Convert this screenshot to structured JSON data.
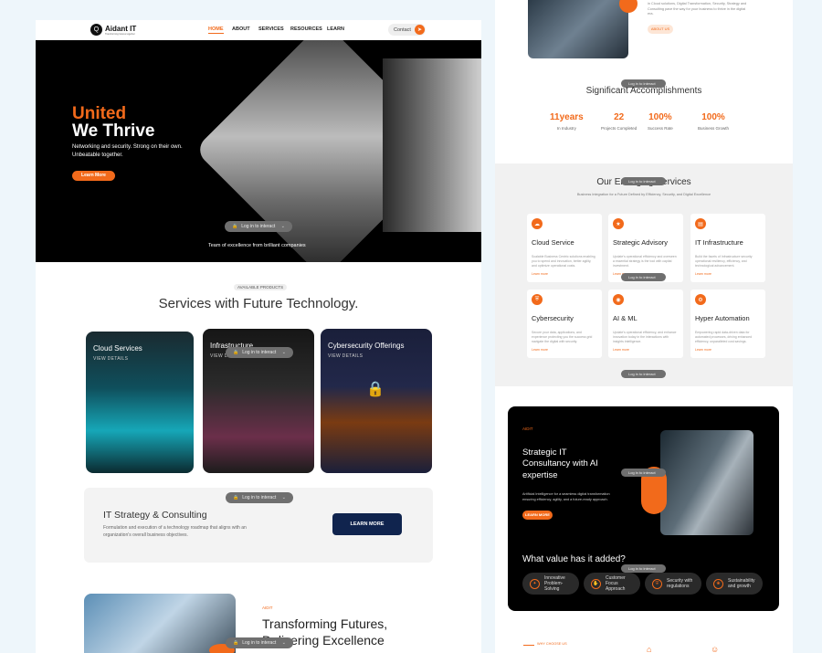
{
  "nav": {
    "logo": "Aidant IT",
    "logo_tagline": "Transforming futures together",
    "links": [
      "HOME",
      "ABOUT",
      "SERVICES",
      "RESOURCES",
      "LEARN"
    ],
    "contact": "Contact"
  },
  "hero": {
    "title_orange": "United",
    "title_white": "We Thrive",
    "subtitle": "Networking and security. Strong on their own. Unbeatable together.",
    "cta": "Learn More",
    "login_pill": "Log in to interact",
    "team_text": "Team of excellence from brilliant companies"
  },
  "products": {
    "badge": "AVAILABLE PRODUCTS",
    "heading": "Services with Future Technology.",
    "cards": [
      {
        "title": "Cloud Services",
        "view": "VIEW DETAILS"
      },
      {
        "title": "Infrastructure",
        "view": "VIEW DETAILS"
      },
      {
        "title": "Cybersecurity Offerings",
        "view": "VIEW DETAILS"
      }
    ],
    "strategy_title": "IT Strategy & Consulting",
    "strategy_desc": "Formulation and execution of a technology roadmap that aligns with an organization's overall business objectives.",
    "strategy_btn": "LEARN MORE"
  },
  "transform": {
    "tag": "AIDIT",
    "heading_line1": "Transforming Futures,",
    "heading_line2": "Delivering Excellence"
  },
  "about": {
    "text": "in Cloud solutions, Digital Transformation, Security, Strategy and Consulting pave the way for your business to thrive in the digital era.",
    "btn": "ABOUT US"
  },
  "accomplishments": {
    "heading": "Significant Accomplishments",
    "stats": [
      {
        "value": "11years",
        "label": "In Industry"
      },
      {
        "value": "22",
        "label": "Projects Completed"
      },
      {
        "value": "100%",
        "label": "Success Rate"
      },
      {
        "value": "100%",
        "label": "Business Growth"
      }
    ]
  },
  "emerging": {
    "heading": "Our Emerging Services",
    "subheading": "Business Integration for a Future Defined by Efficiency, Security, and Digital Excellence",
    "cards": [
      {
        "title": "Cloud Service",
        "desc": "Scalable Business Centric solutions enabling you to spend and innovation, better agility, and optimize operational costs.",
        "link": "Learn more"
      },
      {
        "title": "Strategic Advisory",
        "desc": "Update's operational efficiency and overseen a essential strategy is the tool with capital investment.",
        "link": "Learn more"
      },
      {
        "title": "IT Infrastructure",
        "desc": "Build the facets of Infrastructure security operational resiliency, efficiency, and technological advancement.",
        "link": "Learn more"
      },
      {
        "title": "Cybersecurity",
        "desc": "Secure your data, applications, and experience protecting you the success grid navigate the digital with security.",
        "link": "Learn more"
      },
      {
        "title": "AI & ML",
        "desc": "Update's operational efficiency, and enhance innovation today in the interactions with insights intelligence.",
        "link": "Learn more"
      },
      {
        "title": "Hyper Automation",
        "desc": "Empowering rapid data-driven data for automated processes, driving enhanced efficiency, unparalleled cost savings.",
        "link": "Learn more"
      }
    ]
  },
  "ai": {
    "tag": "AIDIT",
    "heading": "Strategic IT Consultancy with AI expertise",
    "desc": "Artificial Intelligence for a seamless digital transformation ensuring efficiency, agility, and a future-ready approach.",
    "btn": "LEARN MORE",
    "value_heading": "What value has it added?",
    "chips": [
      "Innovative Problem-Solving",
      "Customer Focus Approach",
      "Security with regulations",
      "Sustainability and growth"
    ]
  },
  "why": {
    "tag": "WHY CHOOSE US"
  },
  "colors": {
    "accent": "#f26a1b",
    "dark": "#000000",
    "page_bg": "#eef6fb",
    "light_section": "#f1f1f1"
  }
}
